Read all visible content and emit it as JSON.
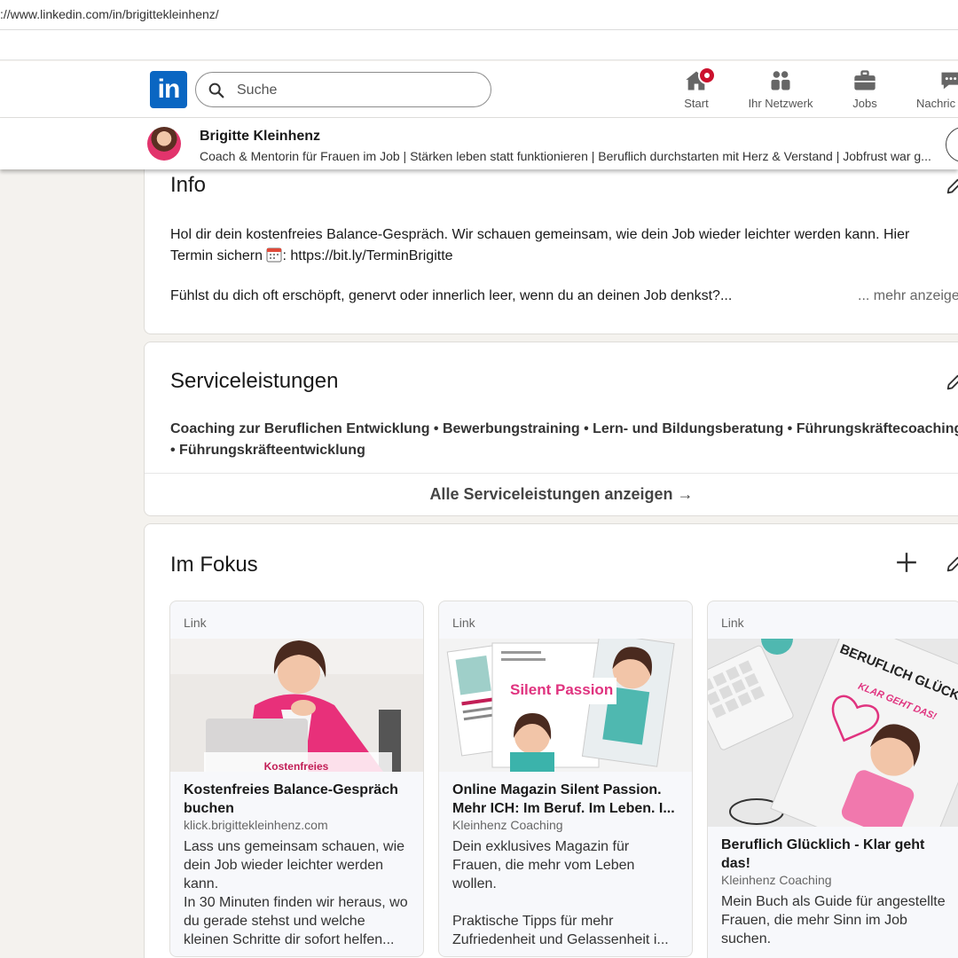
{
  "browser": {
    "url": "://www.linkedin.com/in/brigittekleinhenz/"
  },
  "nav": {
    "logo": "in",
    "search_placeholder": "Suche",
    "items": [
      {
        "label": "Start",
        "icon": "home-icon"
      },
      {
        "label": "Ihr Netzwerk",
        "icon": "network-icon"
      },
      {
        "label": "Jobs",
        "icon": "briefcase-icon"
      },
      {
        "label": "Nachric",
        "icon": "messaging-icon"
      }
    ]
  },
  "sticky": {
    "name": "Brigitte Kleinhenz",
    "headline": "Coach & Mentorin für Frauen im Job | Stärken leben statt funktionieren | Beruflich durchstarten mit Herz & Verstand | Jobfrust war g..."
  },
  "info": {
    "title": "Info",
    "line1": "Hol dir dein kostenfreies Balance-Gespräch. Wir schauen gemeinsam, wie dein Job wieder leichter werden kann. Hier Termin sichern",
    "link": ": https://bit.ly/TerminBrigitte",
    "line2": "Fühlst du dich oft erschöpft, genervt oder innerlich leer, wenn du an deinen Job denkst?...",
    "more": "... mehr anzeige"
  },
  "services": {
    "title": "Serviceleistungen",
    "text": "Coaching zur Beruflichen Entwicklung • Bewerbungstraining • Lern- und Bildungsberatung • Führungskräftecoaching • Führungskräfteentwicklung",
    "show_all": "Alle Serviceleistungen anzeigen →"
  },
  "fokus": {
    "title": "Im Fokus",
    "items": [
      {
        "type": "Link",
        "thumb_text": "Kostenfreies",
        "title": "Kostenfreies Balance-Gespräch buchen",
        "source": "klick.brigittekleinhenz.com",
        "desc": "Lass uns gemeinsam schauen, wie dein Job wieder leichter werden kann.\nIn 30 Minuten finden wir heraus, wo du gerade stehst und welche kleinen Schritte dir sofort helfen..."
      },
      {
        "type": "Link",
        "thumb_text": "Silent Passion",
        "title": "Online Magazin Silent Passion. Mehr ICH: Im Beruf. Im Leben. I...",
        "source": "Kleinhenz Coaching",
        "desc": "Dein exklusives Magazin für Frauen, die mehr vom Leben wollen.\n\nPraktische Tipps für mehr Zufriedenheit und Gelassenheit i..."
      },
      {
        "type": "Link",
        "thumb_text": "BERUFLICH GLÜCKLICH",
        "thumb_sub": "KLAR GEHT DAS!",
        "title": "Beruflich Glücklich - Klar geht das!",
        "source": "Kleinhenz Coaching",
        "desc": "Mein Buch als Guide für angestellte Frauen, die mehr Sinn im Job suchen."
      }
    ]
  },
  "colors": {
    "brand": "#0a66c2",
    "badge": "#cb112d",
    "accent_pink": "#e2346c"
  }
}
